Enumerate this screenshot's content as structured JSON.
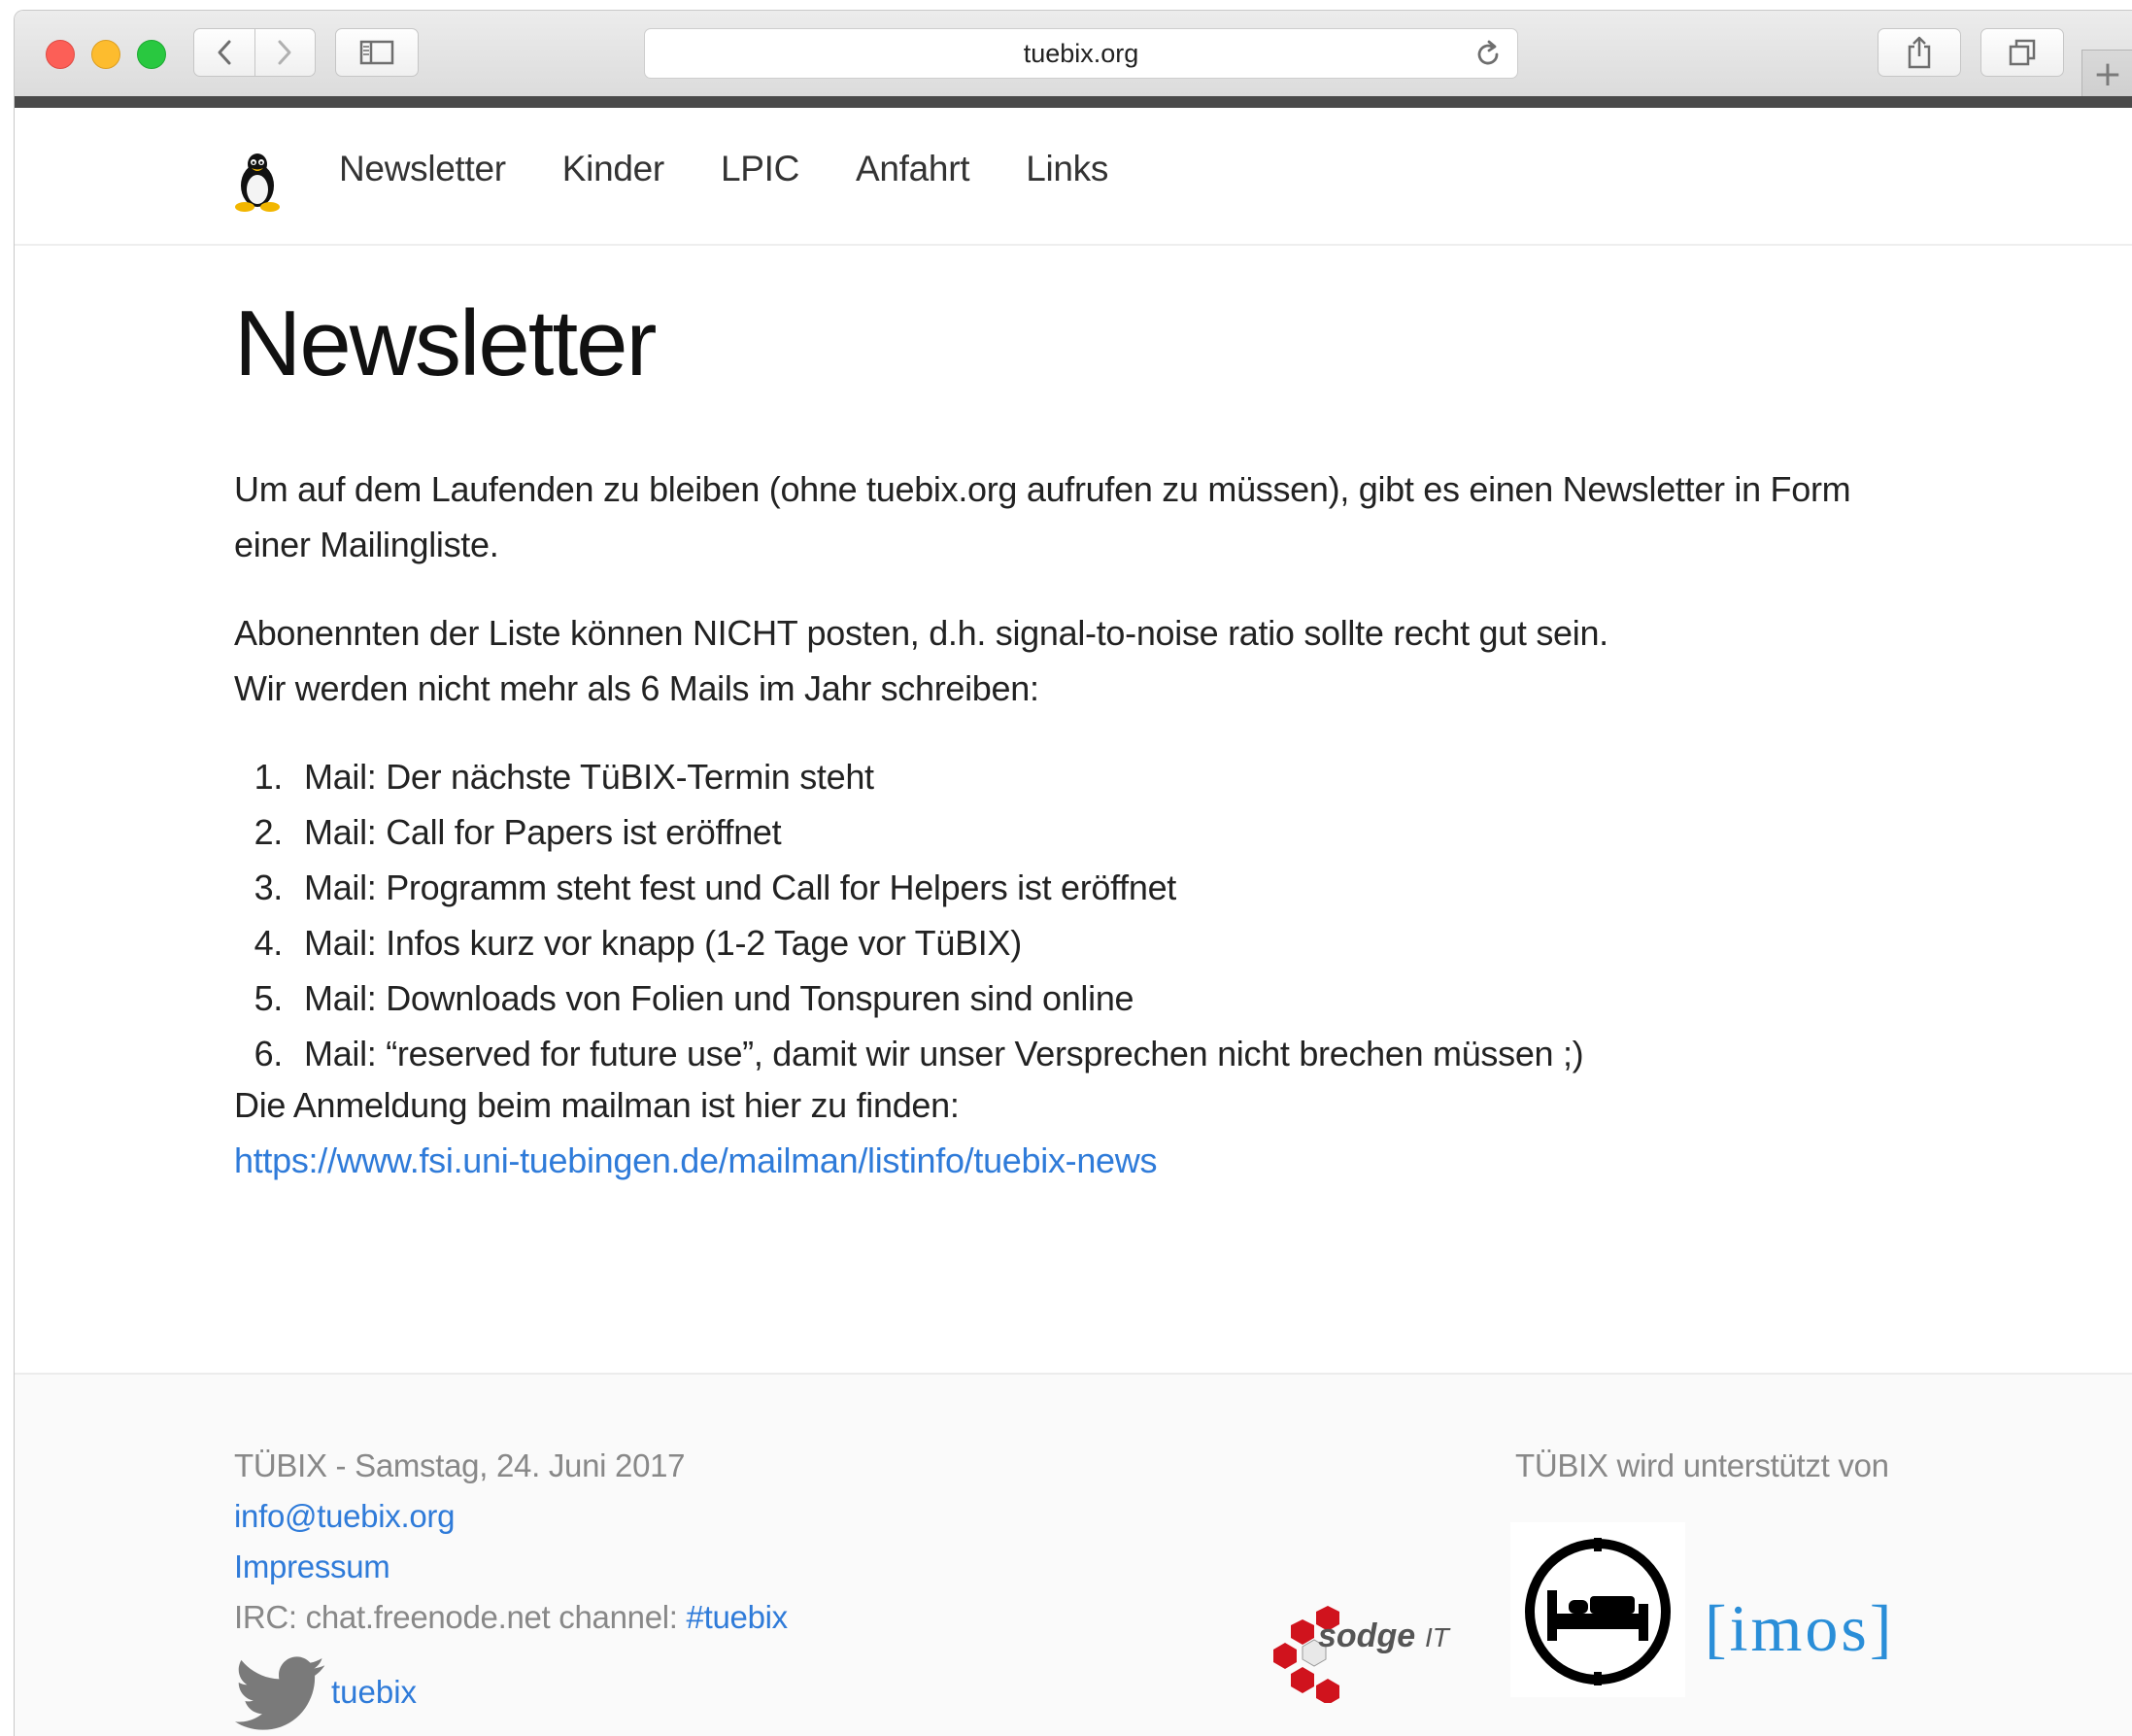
{
  "browser": {
    "url": "tuebix.org"
  },
  "nav": {
    "logo_icon": "tux-penguin-icon",
    "items": [
      {
        "label": "Newsletter"
      },
      {
        "label": "Kinder"
      },
      {
        "label": "LPIC"
      },
      {
        "label": "Anfahrt"
      },
      {
        "label": "Links"
      }
    ]
  },
  "main": {
    "title": "Newsletter",
    "paragraph1": "Um auf dem Laufenden zu bleiben (ohne tuebix.org aufrufen zu müssen), gibt es einen Newsletter in Form einer Mailingliste.",
    "paragraph2_line1": "Abonennten der Liste können NICHT posten, d.h. signal-to-noise ratio sollte recht gut sein.",
    "paragraph2_line2": "Wir werden nicht mehr als 6 Mails im Jahr schreiben:",
    "steps": [
      {
        "num": "1.",
        "text": "Mail: Der nächste TüBIX-Termin steht"
      },
      {
        "num": "2.",
        "text": "Mail: Call for Papers ist eröffnet"
      },
      {
        "num": "3.",
        "text": "Mail: Programm steht fest und Call for Helpers ist eröffnet"
      },
      {
        "num": "4.",
        "text": "Mail: Infos kurz vor knapp (1-2 Tage vor TüBIX)"
      },
      {
        "num": "5.",
        "text": "Mail: Downloads von Folien und Tonspuren sind online"
      },
      {
        "num": "6.",
        "text": "Mail: “reserved for future use”, damit wir unser Versprechen nicht brechen müssen ;)"
      }
    ],
    "signup_text": "Die Anmeldung beim mailman ist hier zu finden:",
    "signup_link": "https://www.fsi.uni-tuebingen.de/mailman/listinfo/tuebix-news"
  },
  "footer": {
    "event": "TÜBIX - Samstag, 24. Juni 2017",
    "email": "info@tuebix.org",
    "impressum": "Impressum",
    "irc_prefix": "IRC: chat.freenode.net channel: ",
    "irc_channel": "#tuebix",
    "twitter_handle": "tuebix",
    "sponsors_heading": "TÜBIX wird unterstützt von",
    "sponsors": [
      {
        "name": "sodge IT",
        "icon": "sodge-it-logo"
      },
      {
        "name": "hotel",
        "icon": "bed-logo"
      },
      {
        "name": "[imos]",
        "icon": "imos-logo"
      }
    ]
  },
  "colors": {
    "link": "#2f7bd9",
    "muted": "#888888",
    "text": "#222222"
  }
}
